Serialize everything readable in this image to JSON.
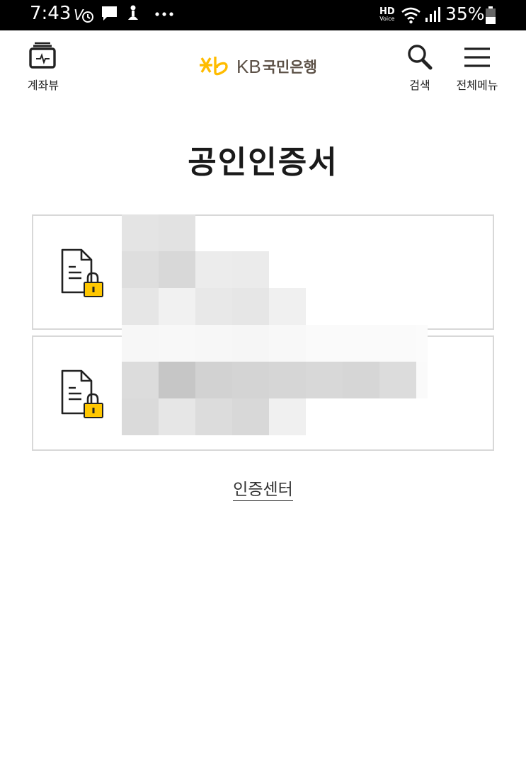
{
  "status_bar": {
    "time": "7:43",
    "battery_percent": "35%",
    "hd_label": "HD",
    "hd_sub": "Voice",
    "icons": [
      "volte-icon",
      "message-icon",
      "accessibility-icon",
      "more-dots-icon",
      "wifi-icon",
      "signal-icon",
      "battery-icon"
    ]
  },
  "app_bar": {
    "account_view_label": "계좌뷰",
    "logo_text": "KB",
    "logo_korean": "국민은행",
    "search_label": "검색",
    "menu_label": "전체메뉴"
  },
  "page": {
    "title": "공인인증서"
  },
  "certificates": [
    {
      "icon": "certificate-lock-icon"
    },
    {
      "icon": "certificate-lock-icon"
    }
  ],
  "footer": {
    "cert_center_link": "인증센터"
  },
  "colors": {
    "brand_yellow": "#ffbc00",
    "logo_brown": "#5c5147",
    "card_border": "#d8d8d8",
    "status_bar_bg": "#000000"
  }
}
